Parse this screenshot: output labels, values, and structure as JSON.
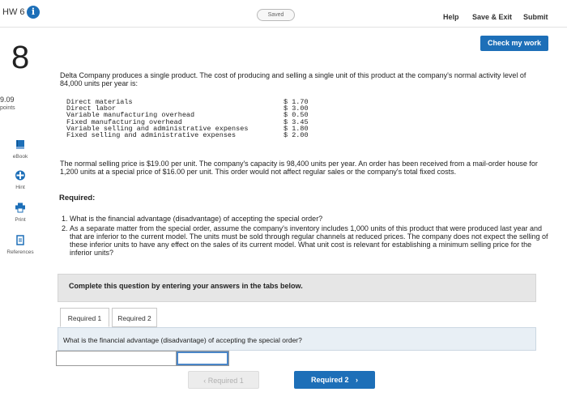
{
  "header": {
    "hw_title": "HW 6",
    "info_glyph": "i",
    "saved_label": "Saved",
    "help_label": "Help",
    "save_exit_label": "Save & Exit",
    "submit_label": "Submit"
  },
  "question": {
    "number": "8",
    "points_value": "9.09",
    "points_label": "points",
    "check_work_label": "Check my work",
    "intro": "Delta Company produces a single product. The cost of producing and selling a single unit of this product at the company's normal activity level of 84,000 units per year is:",
    "costs": [
      {
        "label": "Direct materials",
        "amount": "$ 1.70"
      },
      {
        "label": "Direct labor",
        "amount": "$ 3.00"
      },
      {
        "label": "Variable manufacturing overhead",
        "amount": "$ 0.50"
      },
      {
        "label": "Fixed manufacturing overhead",
        "amount": "$ 3.45"
      },
      {
        "label": "Variable selling and administrative expenses",
        "amount": "$ 1.80"
      },
      {
        "label": "Fixed selling and administrative expenses",
        "amount": "$ 2.00"
      }
    ],
    "paragraph": "The normal selling price is $19.00 per unit. The company's capacity is 98,400 units per year. An order has been received from a mail-order house for 1,200 units at a special price of $16.00 per unit. This order would not affect regular sales or the company's total fixed costs.",
    "required_heading": "Required:",
    "requirements": [
      {
        "num": "1.",
        "text": "What is the financial advantage (disadvantage) of accepting the special order?"
      },
      {
        "num": "2.",
        "text": "As a separate matter from the special order, assume the company's inventory includes 1,000 units of this product that were produced last year and that are inferior to the current model. The units must be sold through regular channels at reduced prices. The company does not expect the selling of these inferior units to have any effect on the sales of its current model. What unit cost is relevant for establishing a minimum selling price for the inferior units?"
      }
    ],
    "instruction": "Complete this question by entering your answers in the tabs below.",
    "tabs": [
      {
        "label": "Required 1"
      },
      {
        "label": "Required 2"
      }
    ],
    "tab_question": "What is the financial advantage (disadvantage) of accepting the special order?",
    "answer_value": ""
  },
  "sidebar": {
    "items": [
      {
        "label": "eBook",
        "icon": "book-icon"
      },
      {
        "label": "Hint",
        "icon": "hint-icon"
      },
      {
        "label": "Print",
        "icon": "printer-icon"
      },
      {
        "label": "References",
        "icon": "references-icon"
      }
    ]
  },
  "navigation": {
    "prev_label": "Required 1",
    "next_label": "Required 2",
    "prev_glyph": "‹",
    "next_glyph": "›"
  },
  "colors": {
    "brand_blue": "#1d6fb8",
    "answer_focus": "#4a86c8"
  }
}
